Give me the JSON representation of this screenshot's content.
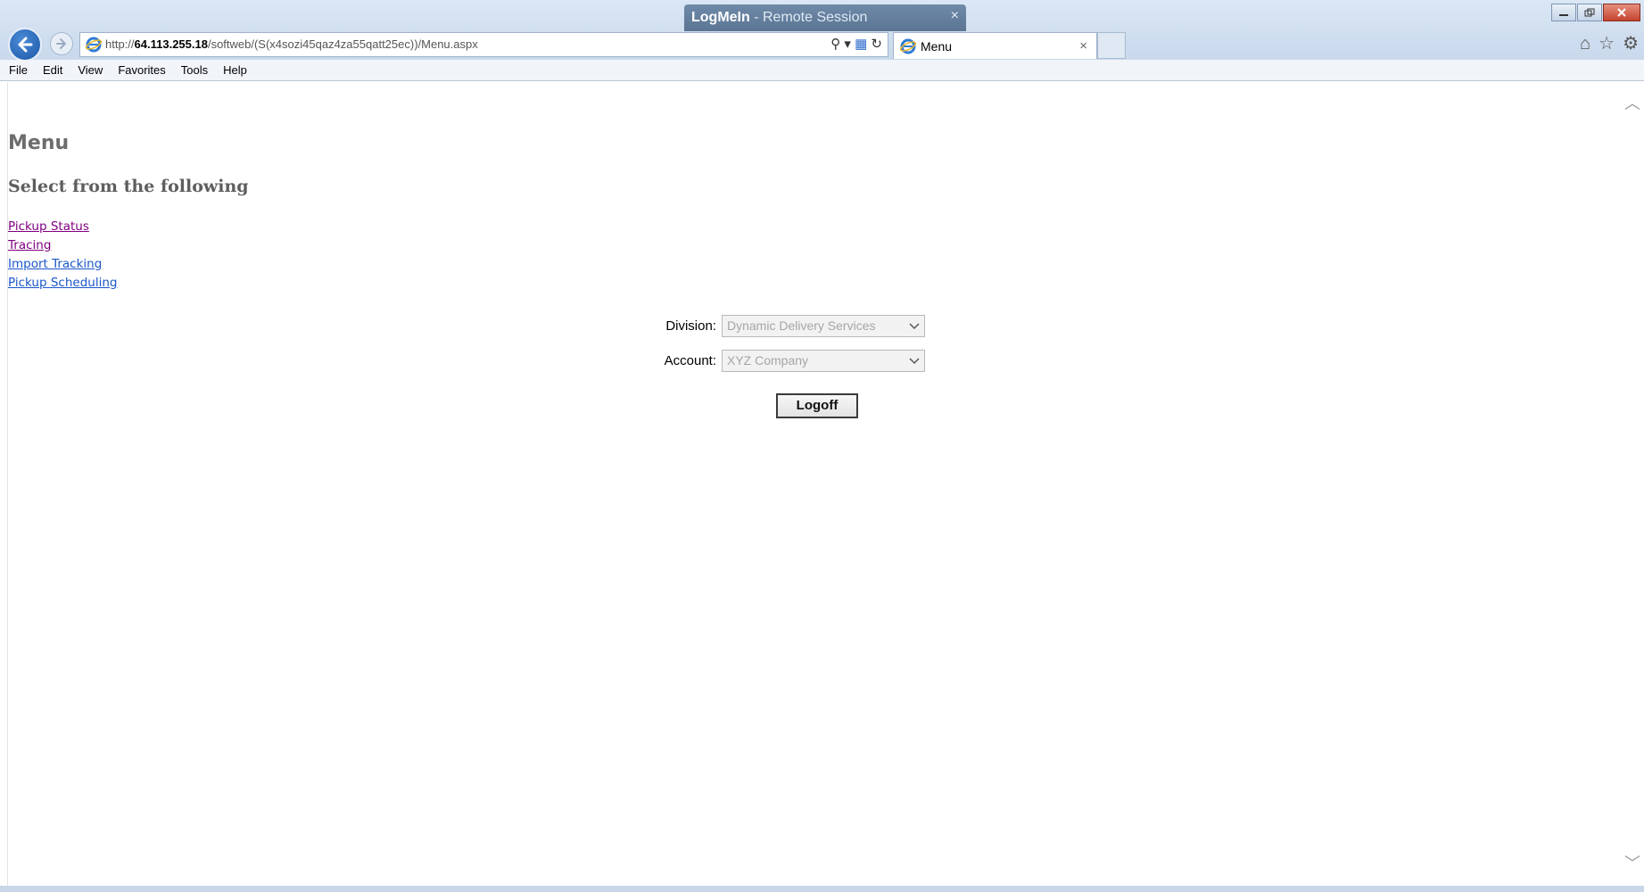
{
  "window": {
    "session_brand": "LogMeIn",
    "session_suffix": "-  Remote Session"
  },
  "address": {
    "url_prefix": "http://",
    "url_host": "64.113.255.18",
    "url_path": "/softweb/(S(x4sozi45qaz4za55qatt25ec))/Menu.aspx"
  },
  "tab": {
    "label": "Menu"
  },
  "menubar": [
    "File",
    "Edit",
    "View",
    "Favorites",
    "Tools",
    "Help"
  ],
  "page": {
    "title": "Menu",
    "subtitle": "Select from the following",
    "links": [
      {
        "label": "Pickup Status",
        "visited": true
      },
      {
        "label": "Tracing",
        "visited": true
      },
      {
        "label": "Import Tracking",
        "visited": false
      },
      {
        "label": "Pickup Scheduling",
        "visited": false
      }
    ],
    "division_label": "Division:",
    "division_value": "Dynamic Delivery Services",
    "account_label": "Account:",
    "account_value": "XYZ Company",
    "logoff_label": "Logoff"
  },
  "icons": {
    "back": "back-arrow-icon",
    "forward": "forward-arrow-icon",
    "home": "home-icon",
    "favorites": "star-icon",
    "tools": "gear-icon"
  },
  "colors": {
    "visited_link": "#800080",
    "unvisited_link": "#1a56c9",
    "heading": "#6d6d6d"
  }
}
